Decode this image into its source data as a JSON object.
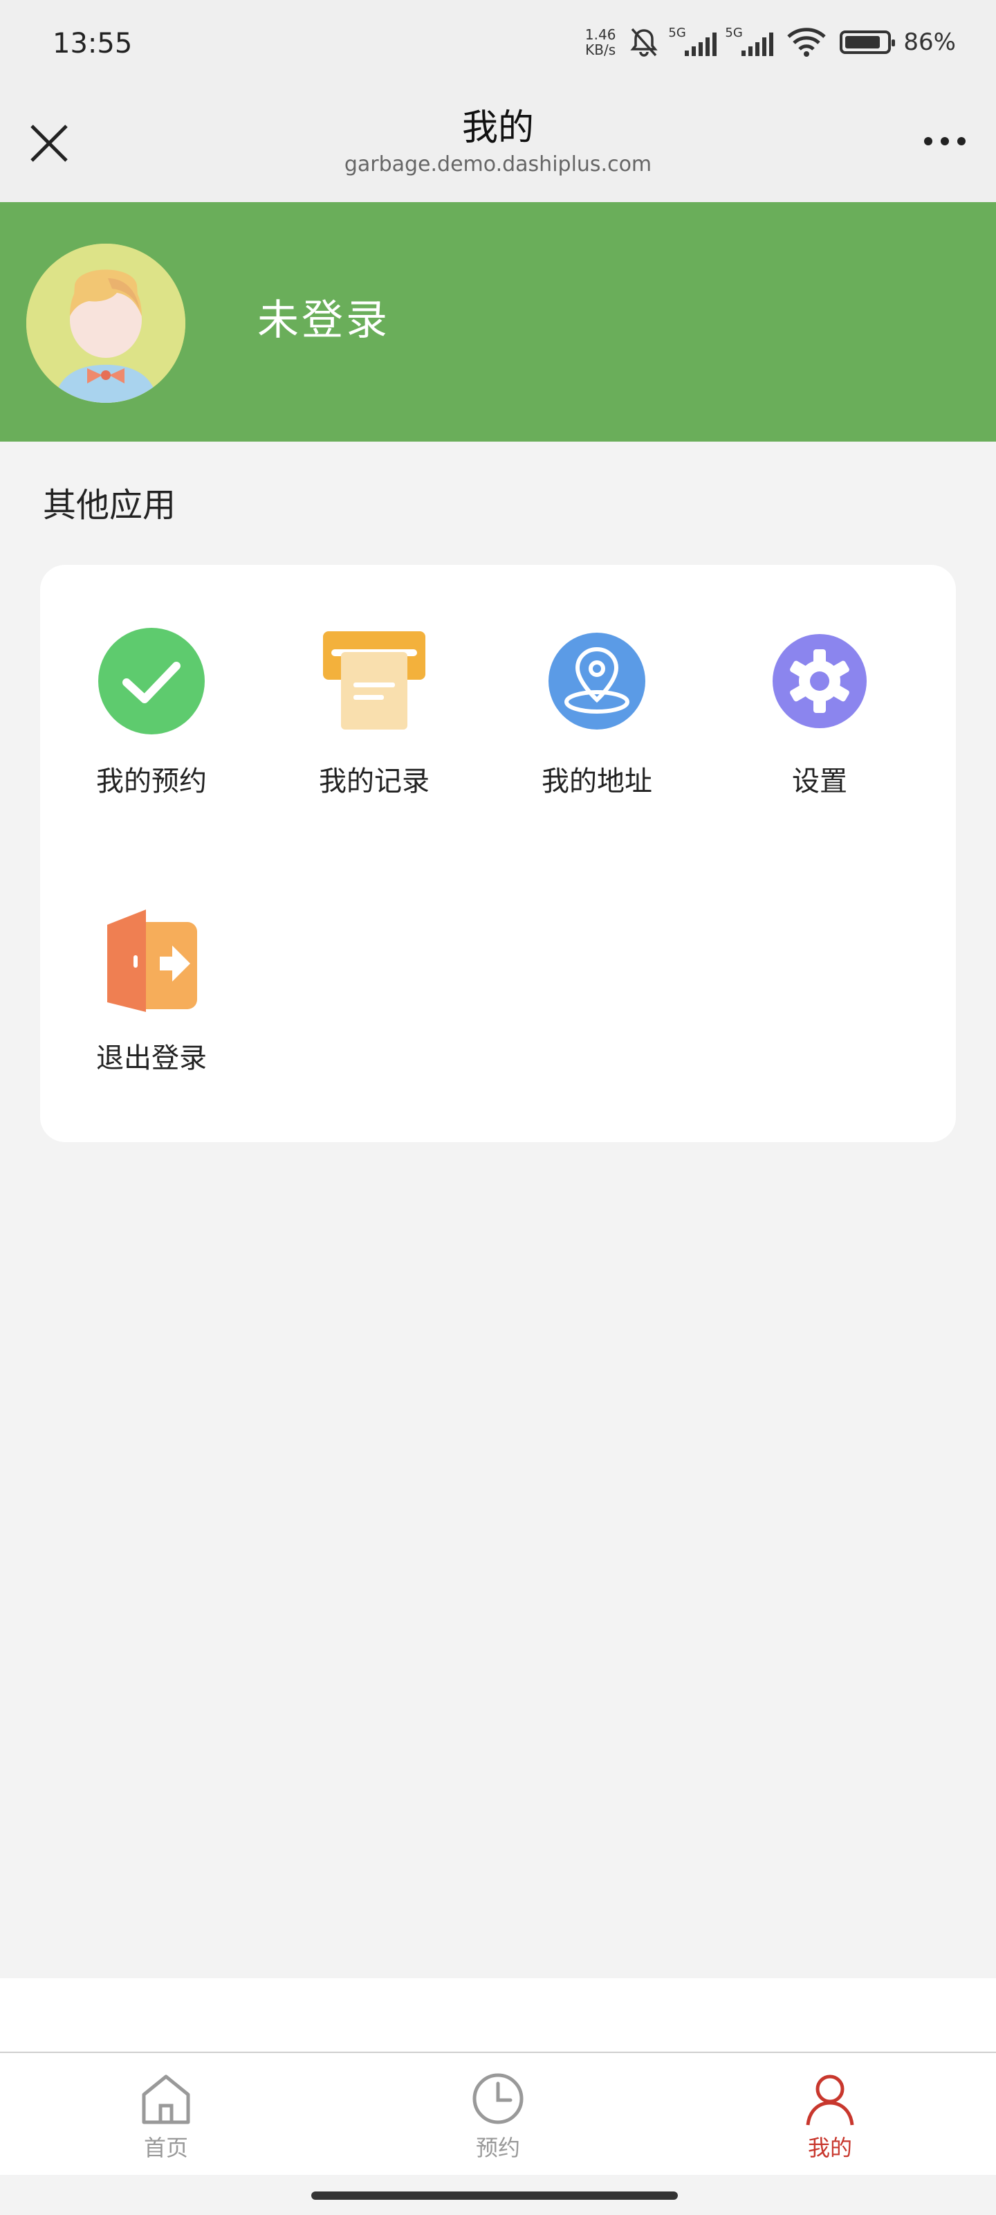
{
  "status_bar": {
    "time": "13:55",
    "net_speed_value": "1.46",
    "net_speed_unit": "KB/s",
    "signal1_label": "5G",
    "signal2_label": "5G",
    "battery_percent": "86%",
    "battery_level": 0.86
  },
  "header": {
    "title": "我的",
    "url": "garbage.demo.dashiplus.com"
  },
  "profile": {
    "name": "未登录",
    "banner_color": "#6aae5a"
  },
  "section": {
    "title": "其他应用"
  },
  "apps": [
    {
      "label": "我的预约",
      "icon": "check-circle-icon",
      "color": "#5ecb6e"
    },
    {
      "label": "我的记录",
      "icon": "receipt-icon",
      "color": "#f3b13c"
    },
    {
      "label": "我的地址",
      "icon": "location-pin-icon",
      "color": "#5b9be6"
    },
    {
      "label": "设置",
      "icon": "gear-icon",
      "color": "#8b85ee"
    },
    {
      "label": "退出登录",
      "icon": "logout-door-icon",
      "color": "#ef7f52"
    }
  ],
  "tabbar": {
    "items": [
      {
        "label": "首页",
        "icon": "home-icon",
        "active": false
      },
      {
        "label": "预约",
        "icon": "clock-icon",
        "active": false
      },
      {
        "label": "我的",
        "icon": "user-icon",
        "active": true
      }
    ],
    "active_color": "#c8372d",
    "inactive_color": "#999999"
  }
}
